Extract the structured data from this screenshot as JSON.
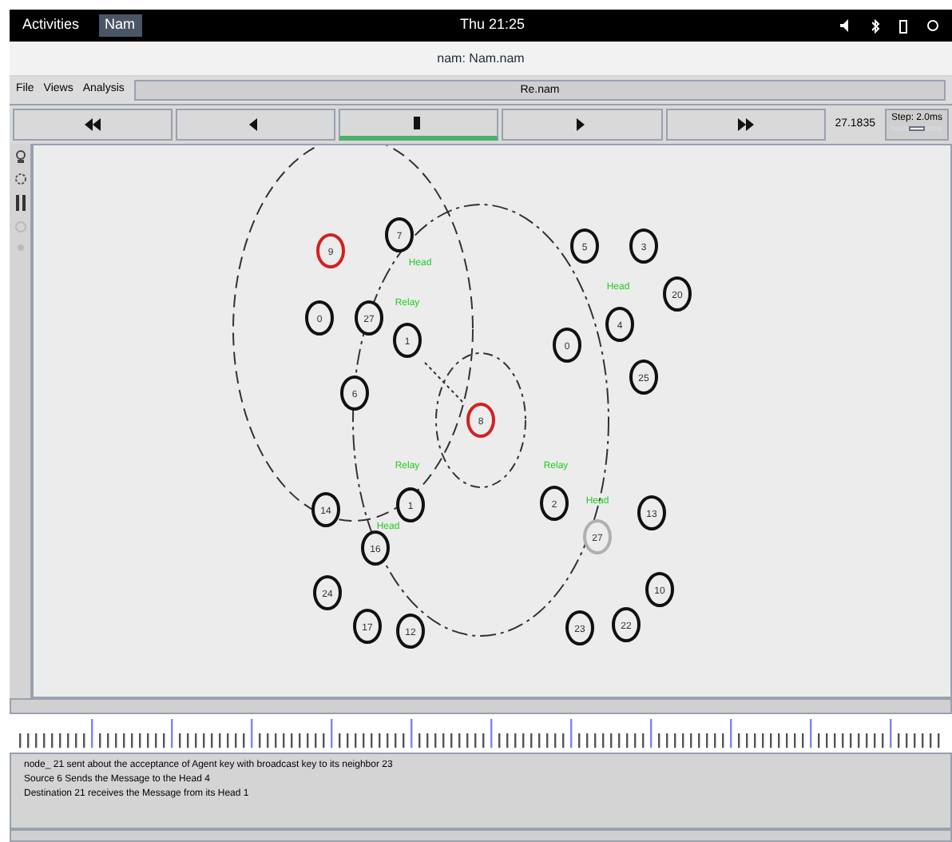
{
  "top_bar": {
    "activities": "Activities",
    "app": "Nam",
    "clock": "Thu 21:25"
  },
  "window": {
    "title": "nam: Nam.nam"
  },
  "menu": [
    "File",
    "Views",
    "Analysis"
  ],
  "file_field": "Re.nam",
  "controls": [
    {
      "kind": "rewind",
      "selected": false
    },
    {
      "kind": "back",
      "selected": false
    },
    {
      "kind": "stop",
      "selected": true
    },
    {
      "kind": "play",
      "selected": false
    },
    {
      "kind": "forward",
      "selected": false
    }
  ],
  "time": "27.1835",
  "step": {
    "label": "Step: 2.0ms",
    "level": 0.5
  },
  "nodes": [
    {
      "label": "9",
      "color": "#d42020"
    },
    {
      "label": "7",
      "color": "#111111"
    },
    {
      "label": "0",
      "color": "#111111"
    },
    {
      "label": "27",
      "color": "#111111"
    },
    {
      "label": "1",
      "color": "#111111"
    },
    {
      "label": "6",
      "color": "#111111"
    },
    {
      "label": "8",
      "color": "#d42020"
    },
    {
      "label": "5",
      "color": "#111111"
    },
    {
      "label": "3",
      "color": "#111111"
    },
    {
      "label": "20",
      "color": "#111111"
    },
    {
      "label": "4",
      "color": "#111111"
    },
    {
      "label": "0",
      "color": "#111111"
    },
    {
      "label": "25",
      "color": "#111111"
    },
    {
      "label": "14",
      "color": "#111111"
    },
    {
      "label": "1",
      "color": "#111111"
    },
    {
      "label": "16",
      "color": "#111111"
    },
    {
      "label": "24",
      "color": "#111111"
    },
    {
      "label": "17",
      "color": "#111111"
    },
    {
      "label": "12",
      "color": "#111111"
    },
    {
      "label": "2",
      "color": "#111111"
    },
    {
      "label": "27",
      "color": "#b0b0b0"
    },
    {
      "label": "13",
      "color": "#111111"
    },
    {
      "label": "10",
      "color": "#111111"
    },
    {
      "label": "23",
      "color": "#111111"
    },
    {
      "label": "22",
      "color": "#111111"
    }
  ],
  "node_labels": [
    "Head",
    "Relay",
    "Head",
    "Relay",
    "Head",
    "Relay",
    "Head"
  ],
  "log": [
    "node_ 21 sent about the acceptance of Agent key with broadcast key to its neighbor 23",
    "Source 6 Sends the Message to the Head 4",
    "Destination 21 receives the Message from its Head 1"
  ]
}
